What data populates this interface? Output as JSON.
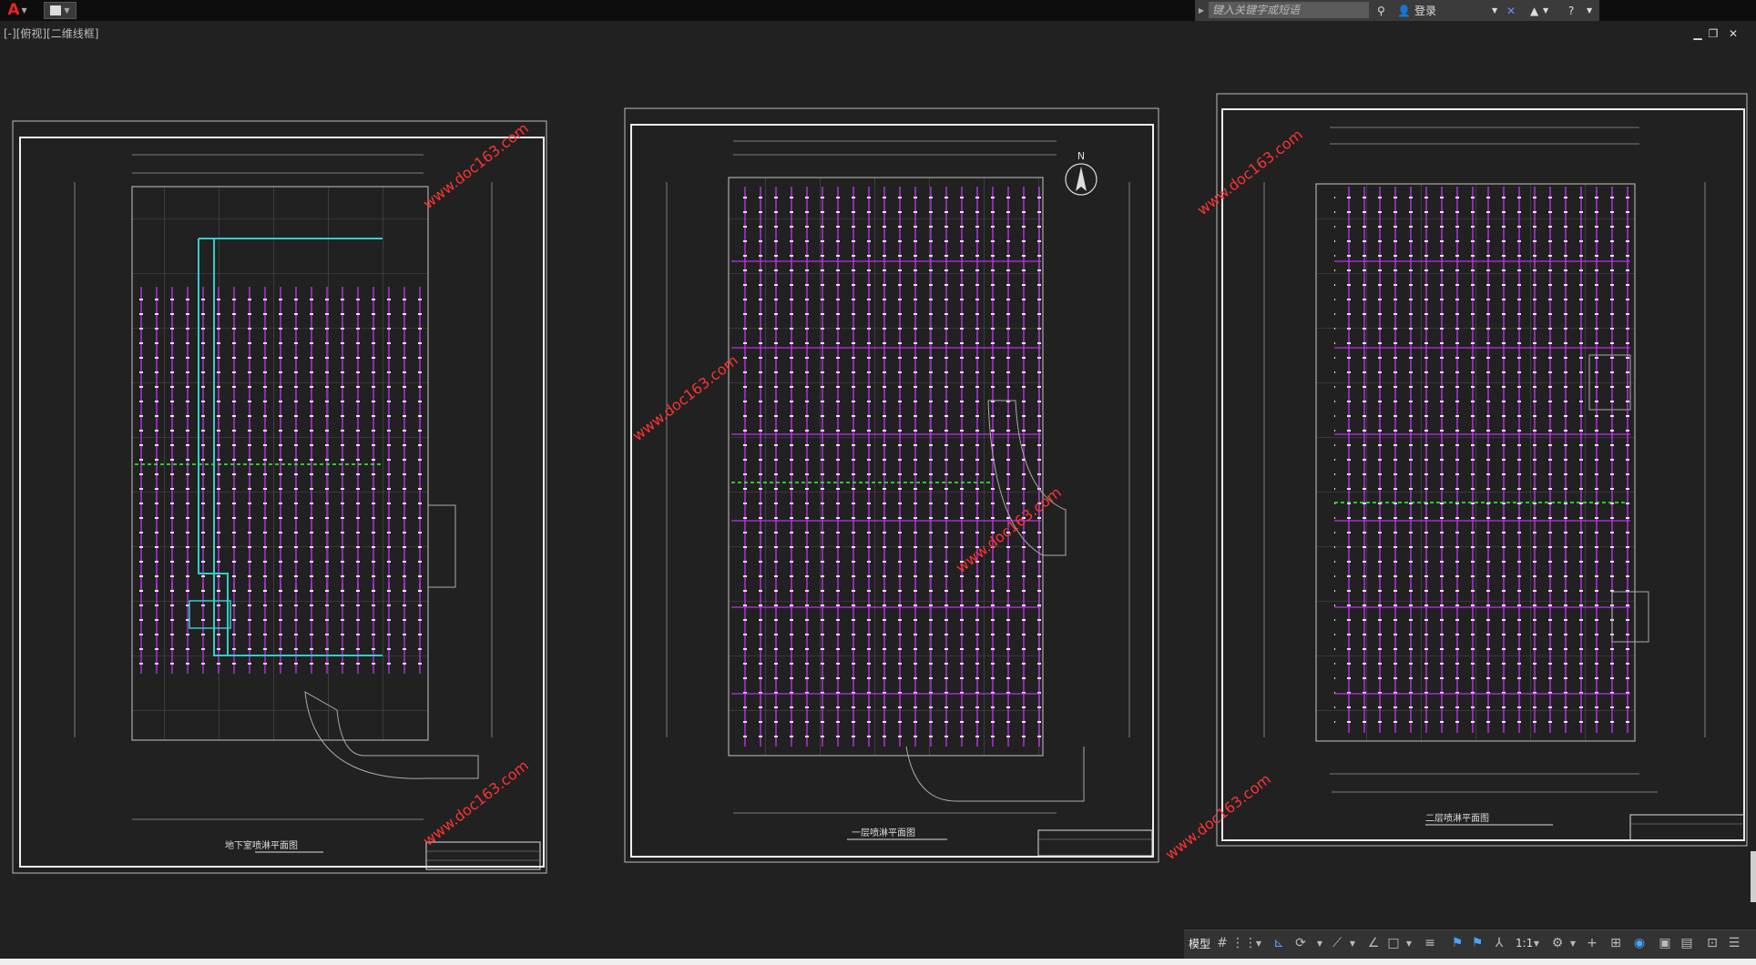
{
  "titlebar": {
    "app_icon": "autocad-logo-icon",
    "search": {
      "placeholder": "键入关键字或短语"
    },
    "login_label": "登录"
  },
  "viewport": {
    "label": "[-][俯视][二维线框]"
  },
  "sheets": [
    {
      "title": "地下室喷淋平面图",
      "watermarks": [
        "www.doc163.com",
        "www.doc163.com"
      ]
    },
    {
      "title": "一层喷淋平面图",
      "north_label": "N",
      "watermarks": [
        "www.doc163.com",
        "www.doc163.com"
      ]
    },
    {
      "title": "二层喷淋平面图",
      "watermarks": [
        "www.doc163.com",
        "www.doc163.com"
      ]
    }
  ],
  "statusbar": {
    "model_label": "模型",
    "scale_label": "1:1"
  },
  "colors": {
    "background": "#212121",
    "sprinkler_lines": "#cc33ff",
    "main_pipe": "#33cccc",
    "accent_green": "#33ff33",
    "watermark": "#ff3333"
  }
}
